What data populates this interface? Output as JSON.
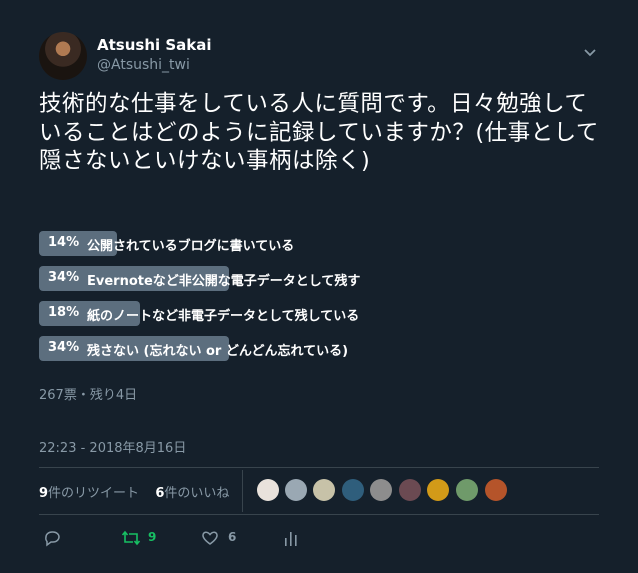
{
  "author": {
    "name": "Atsushi Sakai",
    "handle": "@Atsushi_twi"
  },
  "tweet": {
    "text": "技術的な仕事をしている人に質問です。日々勉強していることはどのように記録していますか？(仕事として隠さないといけない事柄は除く)"
  },
  "poll": {
    "options": [
      {
        "percent": "14%",
        "value": 14,
        "label": "公開されているブログに書いている"
      },
      {
        "percent": "34%",
        "value": 34,
        "label": "Evernoteなど非公開な電子データとして残す"
      },
      {
        "percent": "18%",
        "value": 18,
        "label": "紙のノートなど非電子データとして残している"
      },
      {
        "percent": "34%",
        "value": 34,
        "label": "残さない (忘れない or どんどん忘れている)"
      }
    ],
    "meta": "267票・残り4日"
  },
  "timestamp": "22:23 - 2018年8月16日",
  "stats": {
    "retweet_count": "9",
    "retweet_label": "件のリツイート",
    "like_count": "6",
    "like_label": "件のいいね"
  },
  "likers": [
    {
      "color": "#e9e2dc",
      "icon": "avatar-icon"
    },
    {
      "color": "#9aa8b3",
      "icon": "avatar-icon"
    },
    {
      "color": "#c7c2a8",
      "icon": "avatar-icon"
    },
    {
      "color": "#2f5e7c",
      "icon": "avatar-icon"
    },
    {
      "color": "#8d8d8d",
      "icon": "avatar-icon"
    },
    {
      "color": "#6b4a52",
      "icon": "avatar-icon"
    },
    {
      "color": "#d29a18",
      "icon": "avatar-icon"
    },
    {
      "color": "#6f9a6a",
      "icon": "avatar-icon"
    },
    {
      "color": "#b5542a",
      "icon": "avatar-icon"
    }
  ],
  "actions": {
    "reply_icon": "reply-icon",
    "retweet_count": "9",
    "like_count": "6",
    "analytics_icon": "analytics-icon"
  },
  "colors": {
    "background": "#15202b",
    "muted": "#8899a6",
    "bar": "#5c6e7e",
    "retweet": "#17bf63"
  }
}
